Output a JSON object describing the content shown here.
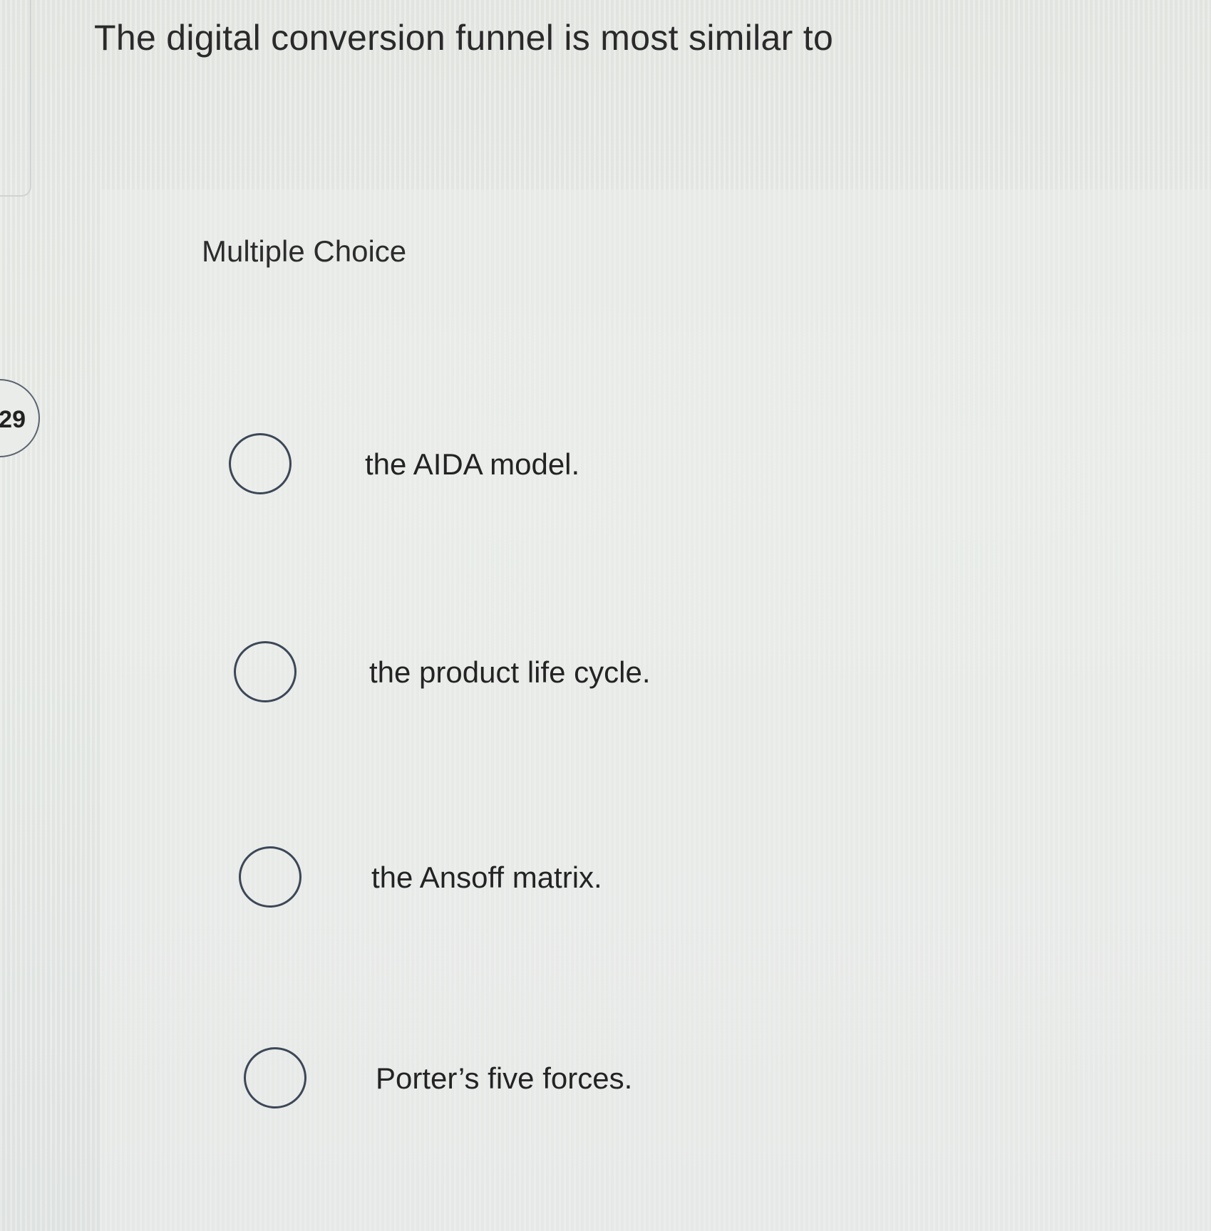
{
  "question": {
    "number": "29",
    "text": "The digital conversion funnel is most similar to"
  },
  "answer_section": {
    "type_label": "Multiple Choice",
    "options": [
      {
        "label": "the AIDA model.",
        "selected": false
      },
      {
        "label": "the product life cycle.",
        "selected": false
      },
      {
        "label": "the Ansoff matrix.",
        "selected": false
      },
      {
        "label": "Porter’s five forces.",
        "selected": false
      }
    ]
  },
  "colors": {
    "background": "#e4e8e6",
    "radio_border": "#3c4757",
    "text": "#2b2b2b"
  }
}
